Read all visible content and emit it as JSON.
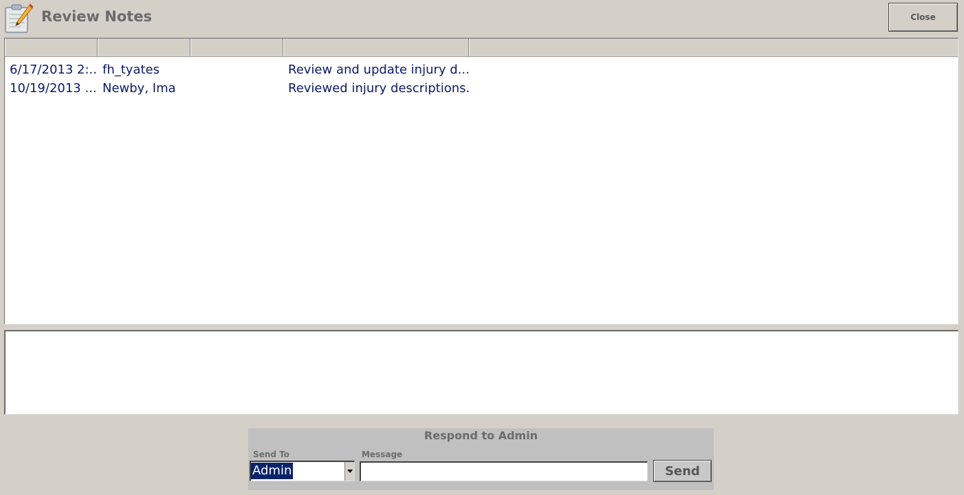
{
  "window": {
    "title": "Review Notes",
    "close_label": "Close",
    "app_icon": "notepad-pencil-icon"
  },
  "notes_list": {
    "columns": [
      "",
      "",
      "",
      "",
      ""
    ],
    "rows": [
      [
        "6/17/2013 2:...",
        "fh_tyates",
        "",
        "Review and update injury d..."
      ],
      [
        "10/19/2013 ...",
        "Newby, Ima",
        "",
        "Reviewed injury descriptions..."
      ]
    ]
  },
  "note_detail": {
    "text": ""
  },
  "respond": {
    "title": "Respond to Admin",
    "send_to_label": "Send To",
    "send_to_value": "Admin",
    "message_label": "Message",
    "message_value": "",
    "send_label": "Send"
  },
  "colors": {
    "background": "#d4d0c8",
    "row_text": "#0a1a6b",
    "selection": "#0a246a"
  }
}
